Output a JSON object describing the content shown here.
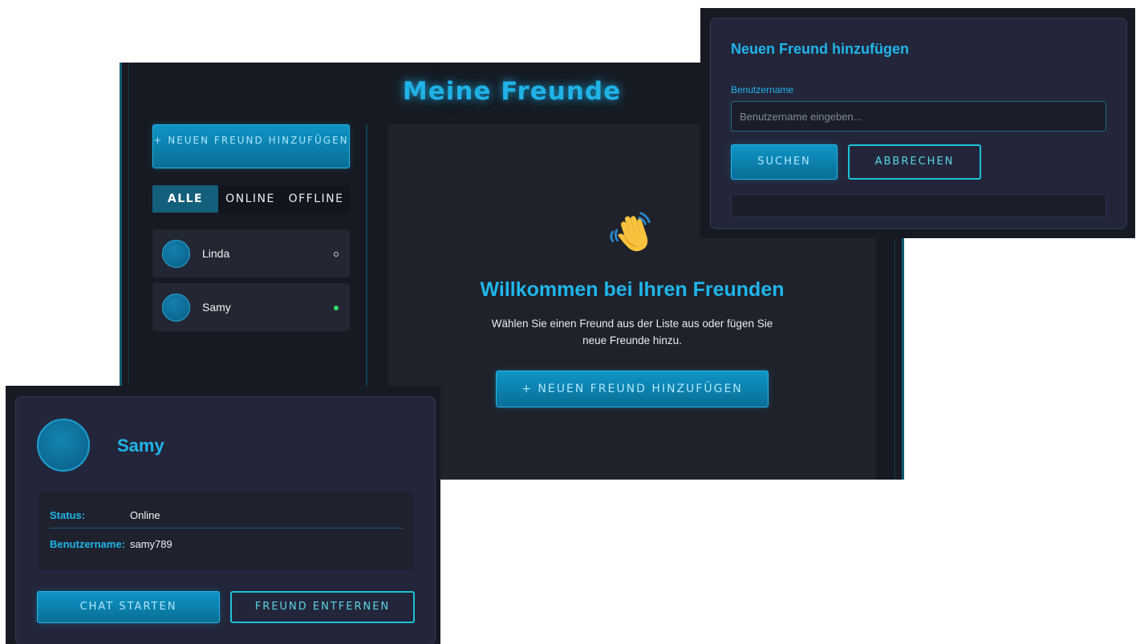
{
  "colors": {
    "accent": "#1fb2e6",
    "background": "#171a22",
    "panel": "#23263a",
    "online": "#35d86a"
  },
  "main": {
    "title": "Meine Freunde",
    "sidebar": {
      "add_button_label": "+ NEUEN FREUND HINZUFÜGEN",
      "tabs": [
        {
          "label": "ALLE",
          "active": true
        },
        {
          "label": "ONLINE",
          "active": false
        },
        {
          "label": "OFFLINE",
          "active": false
        }
      ],
      "friends": [
        {
          "name": "Linda",
          "status": "offline"
        },
        {
          "name": "Samy",
          "status": "online"
        }
      ]
    },
    "welcome": {
      "icon": "waving-hand-icon",
      "title": "Willkommen bei Ihren Freunden",
      "text": "Wählen Sie einen Freund aus der Liste aus oder fügen Sie neue Freunde hinzu.",
      "button_label": "+ NEUEN FREUND HINZUFÜGEN"
    }
  },
  "add_dialog": {
    "title": "Neuen Freund hinzufügen",
    "field_label": "Benutzername",
    "input_value": "",
    "input_placeholder": "Benutzername eingeben...",
    "search_label": "SUCHEN",
    "cancel_label": "ABBRECHEN"
  },
  "friend_detail": {
    "name": "Samy",
    "status_label": "Status:",
    "status_value": "Online",
    "username_label": "Benutzername:",
    "username_value": "samy789",
    "chat_label": "CHAT STARTEN",
    "remove_label": "FREUND ENTFERNEN"
  }
}
